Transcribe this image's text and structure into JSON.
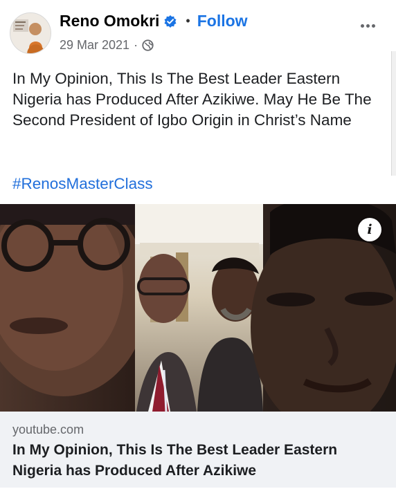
{
  "post": {
    "author": "Reno Omokri",
    "separator": "•",
    "follow_label": "Follow",
    "date": "29 Mar 2021",
    "meta_separator": "·",
    "text": "In My Opinion, This Is The Best Leader Eastern Nigeria has Produced After Azikiwe. May He Be The Second President of Igbo Origin in Christ’s Name",
    "hashtag": "#RenosMasterClass"
  },
  "video": {
    "info_label": "i"
  },
  "link_preview": {
    "domain": "youtube.com",
    "title": "In My Opinion, This Is The Best Leader Eastern Nigeria has Produced After Azikiwe"
  },
  "colors": {
    "follow_blue": "#1b74e4",
    "verified_blue": "#1b74e4",
    "hashtag_blue": "#216fdb",
    "meta_gray": "#65676b",
    "card_bg": "#f0f2f5"
  },
  "icons": [
    "verified-badge-icon",
    "globe-icon",
    "more-options-icon",
    "info-icon"
  ]
}
